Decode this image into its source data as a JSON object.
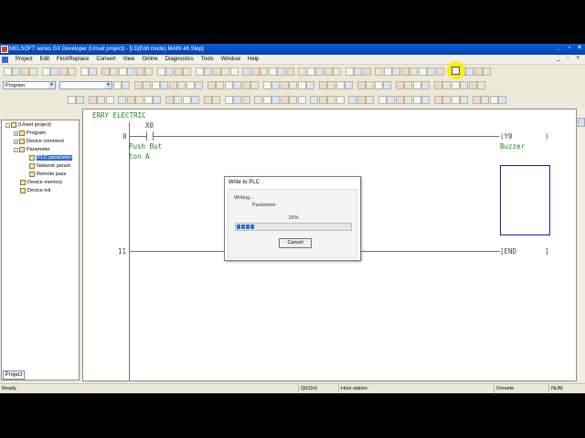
{
  "window": {
    "title": "MELSOFT series GX Developer (Unset project) - [LD(Edit mode)    MAIN    46 Step]",
    "controls": [
      "_",
      "▫",
      "×"
    ],
    "mdi_controls": [
      "_",
      "▫",
      "×"
    ]
  },
  "menu": [
    "Project",
    "Edit",
    "Find/Replace",
    "Convert",
    "View",
    "Online",
    "Diagnostics",
    "Tools",
    "Window",
    "Help"
  ],
  "toolbar": {
    "data_type_select": "Program",
    "device_select": ""
  },
  "project_tree": {
    "root": "(Unset project)",
    "items": [
      "Program",
      "Device comment",
      "Parameter",
      "PLC parameter",
      "Network param",
      "Remote pass",
      "Device memory",
      "Device init"
    ],
    "tab": "Project"
  },
  "ladder": {
    "header": "ERRY ELECTRIC",
    "rung0": {
      "step": "0",
      "contact_device": "X0",
      "contact_comment_1": "Push But",
      "contact_comment_2": "ton A",
      "coil_device": "(Y0",
      "coil_end": ")",
      "coil_comment": "Buzzer"
    },
    "rung1": {
      "step": "11",
      "instruction": "[END",
      "instruction_end": "]"
    }
  },
  "dialog": {
    "title": "Write to PLC",
    "status": "Writing...",
    "target": "Parameter",
    "progress_label": "15%",
    "progress": 0.15,
    "cancel_label": "Cancel"
  },
  "statusbar": {
    "status": "Ready",
    "cpu": "Q02(H)",
    "station": "Host station",
    "mode": "Ovrwrte",
    "num": "NUM"
  },
  "colors": {
    "title_bar": "#0a5fd8",
    "ladder_text": "#208020",
    "progress_fill": "#2f6fd8",
    "highlight": "#fff000"
  }
}
